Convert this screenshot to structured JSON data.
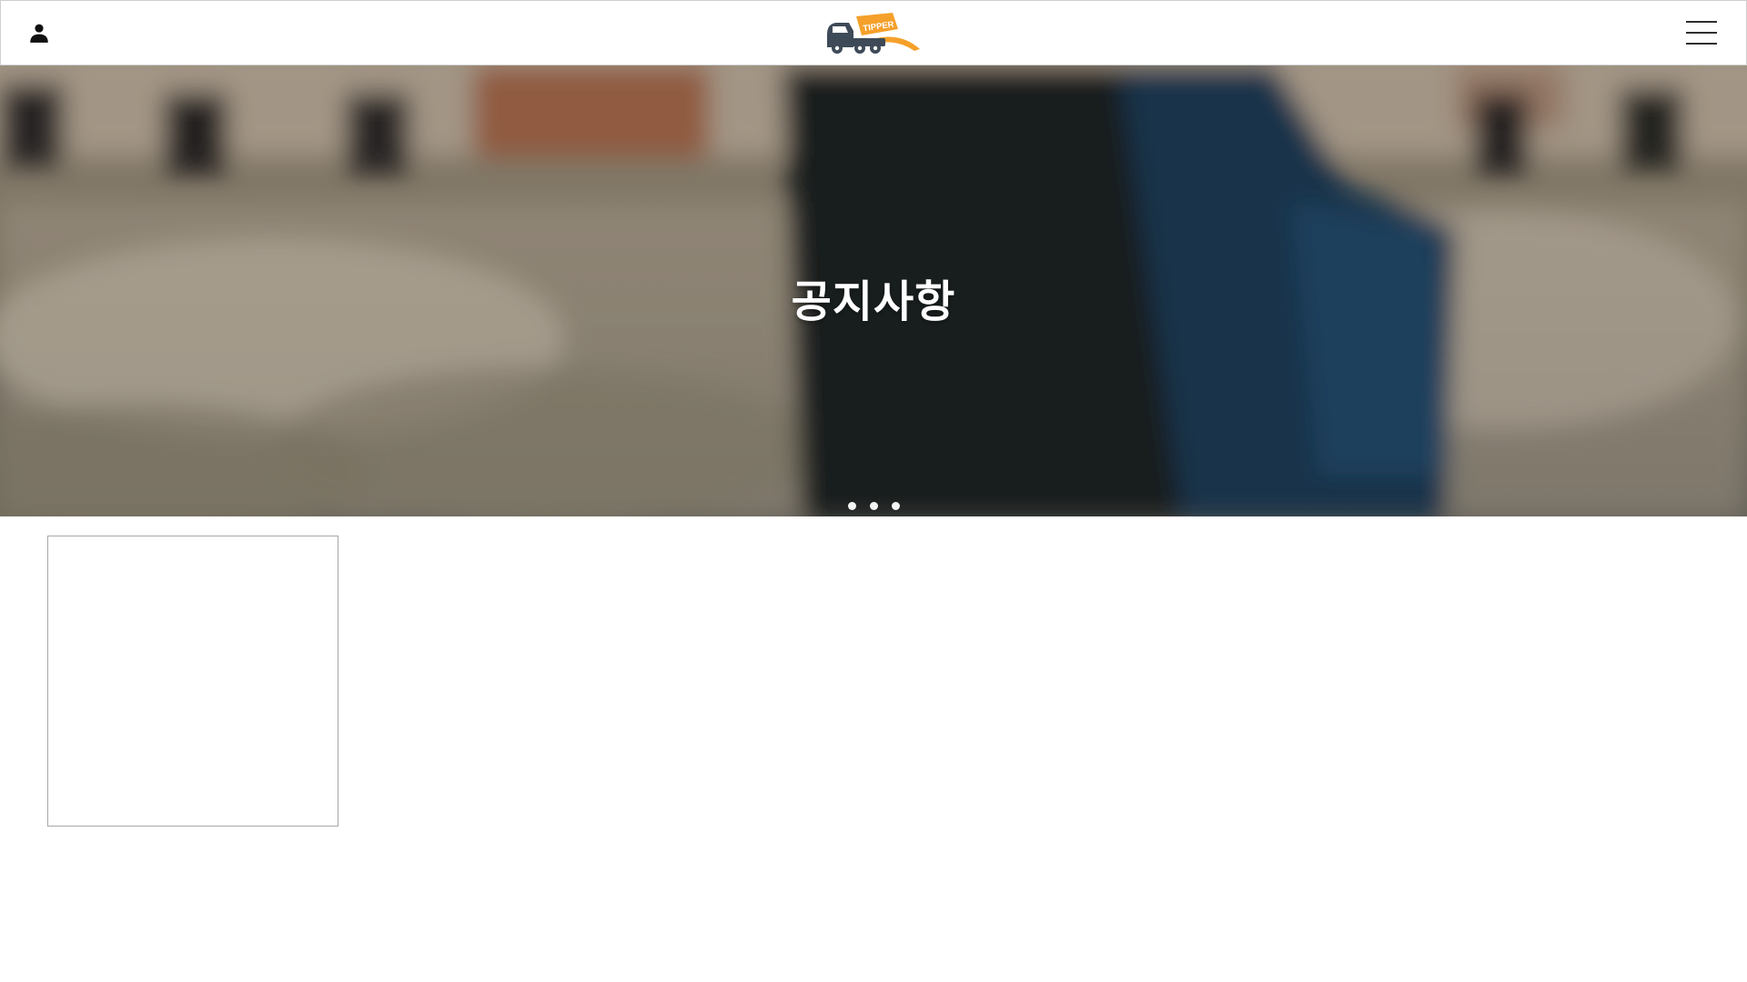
{
  "header": {
    "user_icon": "person-icon",
    "logo_icon": "tipper-truck-logo",
    "logo_text": "TIPPER",
    "menu_icon": "hamburger-menu-icon"
  },
  "hero": {
    "title": "공지사항",
    "slides": 3
  },
  "colors": {
    "brand_orange": "#F5A02A",
    "truck_gray": "#3E4A58",
    "header_border": "#CFCFCF",
    "card_border": "#A7A7A7"
  }
}
